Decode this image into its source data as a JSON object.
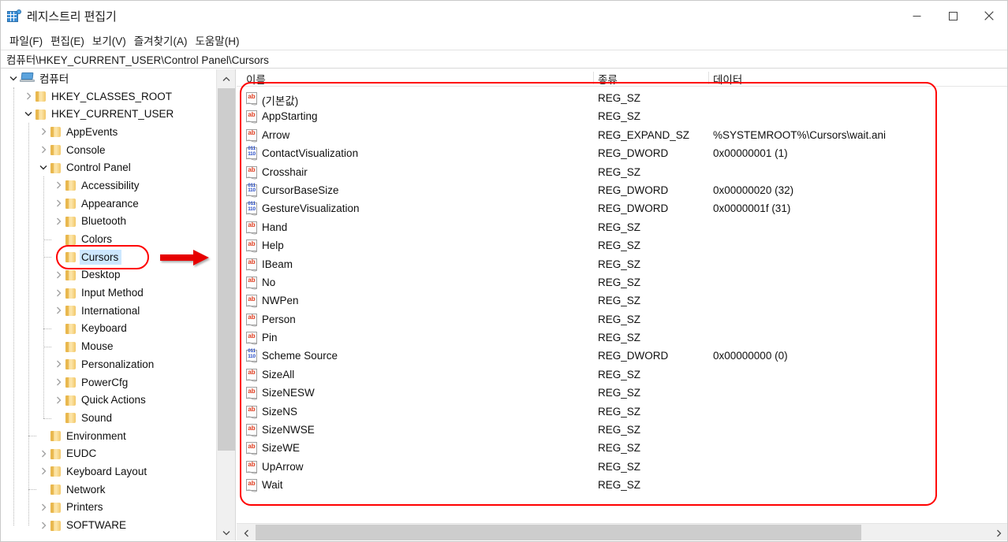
{
  "window": {
    "title": "레지스트리 편집기",
    "icon": "registry-editor-icon",
    "controls": {
      "minimize": "—",
      "maximize": "◻",
      "close": "✕"
    }
  },
  "menubar": {
    "items": [
      {
        "label": "파일(F)",
        "name": "menu-file"
      },
      {
        "label": "편집(E)",
        "name": "menu-edit"
      },
      {
        "label": "보기(V)",
        "name": "menu-view"
      },
      {
        "label": "즐겨찾기(A)",
        "name": "menu-favorites"
      },
      {
        "label": "도움말(H)",
        "name": "menu-help"
      }
    ]
  },
  "addressbar": {
    "path": "컴퓨터\\HKEY_CURRENT_USER\\Control Panel\\Cursors"
  },
  "tree": {
    "nodes": [
      {
        "label": "컴퓨터",
        "depth": 0,
        "expander": "expanded",
        "icon": "computer-icon",
        "selected": false
      },
      {
        "label": "HKEY_CLASSES_ROOT",
        "depth": 1,
        "expander": "collapsed",
        "icon": "folder-icon",
        "selected": false
      },
      {
        "label": "HKEY_CURRENT_USER",
        "depth": 1,
        "expander": "expanded",
        "icon": "folder-icon",
        "selected": false
      },
      {
        "label": "AppEvents",
        "depth": 2,
        "expander": "collapsed",
        "icon": "folder-icon",
        "selected": false
      },
      {
        "label": "Console",
        "depth": 2,
        "expander": "collapsed",
        "icon": "folder-icon",
        "selected": false
      },
      {
        "label": "Control Panel",
        "depth": 2,
        "expander": "expanded",
        "icon": "folder-icon",
        "selected": false
      },
      {
        "label": "Accessibility",
        "depth": 3,
        "expander": "collapsed",
        "icon": "folder-icon",
        "selected": false
      },
      {
        "label": "Appearance",
        "depth": 3,
        "expander": "collapsed",
        "icon": "folder-icon",
        "selected": false
      },
      {
        "label": "Bluetooth",
        "depth": 3,
        "expander": "collapsed",
        "icon": "folder-icon",
        "selected": false
      },
      {
        "label": "Colors",
        "depth": 3,
        "expander": "leaf",
        "icon": "folder-icon",
        "selected": false
      },
      {
        "label": "Cursors",
        "depth": 3,
        "expander": "leaf",
        "icon": "folder-icon",
        "selected": true
      },
      {
        "label": "Desktop",
        "depth": 3,
        "expander": "collapsed",
        "icon": "folder-icon",
        "selected": false
      },
      {
        "label": "Input Method",
        "depth": 3,
        "expander": "collapsed",
        "icon": "folder-icon",
        "selected": false
      },
      {
        "label": "International",
        "depth": 3,
        "expander": "collapsed",
        "icon": "folder-icon",
        "selected": false
      },
      {
        "label": "Keyboard",
        "depth": 3,
        "expander": "leaf",
        "icon": "folder-icon",
        "selected": false
      },
      {
        "label": "Mouse",
        "depth": 3,
        "expander": "leaf",
        "icon": "folder-icon",
        "selected": false
      },
      {
        "label": "Personalization",
        "depth": 3,
        "expander": "collapsed",
        "icon": "folder-icon",
        "selected": false
      },
      {
        "label": "PowerCfg",
        "depth": 3,
        "expander": "collapsed",
        "icon": "folder-icon",
        "selected": false
      },
      {
        "label": "Quick Actions",
        "depth": 3,
        "expander": "collapsed",
        "icon": "folder-icon",
        "selected": false
      },
      {
        "label": "Sound",
        "depth": 3,
        "expander": "leaf",
        "icon": "folder-icon",
        "selected": false
      },
      {
        "label": "Environment",
        "depth": 2,
        "expander": "leaf",
        "icon": "folder-icon",
        "selected": false
      },
      {
        "label": "EUDC",
        "depth": 2,
        "expander": "collapsed",
        "icon": "folder-icon",
        "selected": false
      },
      {
        "label": "Keyboard Layout",
        "depth": 2,
        "expander": "collapsed",
        "icon": "folder-icon",
        "selected": false
      },
      {
        "label": "Network",
        "depth": 2,
        "expander": "leaf",
        "icon": "folder-icon",
        "selected": false
      },
      {
        "label": "Printers",
        "depth": 2,
        "expander": "collapsed",
        "icon": "folder-icon",
        "selected": false
      },
      {
        "label": "SOFTWARE",
        "depth": 2,
        "expander": "collapsed",
        "icon": "folder-icon",
        "selected": false
      }
    ]
  },
  "list": {
    "columns": [
      {
        "label": "이름",
        "name": "column-header-name"
      },
      {
        "label": "종류",
        "name": "column-header-type"
      },
      {
        "label": "데이터",
        "name": "column-header-data"
      }
    ],
    "rows": [
      {
        "name": "(기본값)",
        "type": "REG_SZ",
        "data": "",
        "icon": "string-value-icon"
      },
      {
        "name": "AppStarting",
        "type": "REG_SZ",
        "data": "",
        "icon": "string-value-icon"
      },
      {
        "name": "Arrow",
        "type": "REG_EXPAND_SZ",
        "data": "%SYSTEMROOT%\\Cursors\\wait.ani",
        "icon": "string-value-icon"
      },
      {
        "name": "ContactVisualization",
        "type": "REG_DWORD",
        "data": "0x00000001 (1)",
        "icon": "dword-value-icon"
      },
      {
        "name": "Crosshair",
        "type": "REG_SZ",
        "data": "",
        "icon": "string-value-icon"
      },
      {
        "name": "CursorBaseSize",
        "type": "REG_DWORD",
        "data": "0x00000020 (32)",
        "icon": "dword-value-icon"
      },
      {
        "name": "GestureVisualization",
        "type": "REG_DWORD",
        "data": "0x0000001f (31)",
        "icon": "dword-value-icon"
      },
      {
        "name": "Hand",
        "type": "REG_SZ",
        "data": "",
        "icon": "string-value-icon"
      },
      {
        "name": "Help",
        "type": "REG_SZ",
        "data": "",
        "icon": "string-value-icon"
      },
      {
        "name": "IBeam",
        "type": "REG_SZ",
        "data": "",
        "icon": "string-value-icon"
      },
      {
        "name": "No",
        "type": "REG_SZ",
        "data": "",
        "icon": "string-value-icon"
      },
      {
        "name": "NWPen",
        "type": "REG_SZ",
        "data": "",
        "icon": "string-value-icon"
      },
      {
        "name": "Person",
        "type": "REG_SZ",
        "data": "",
        "icon": "string-value-icon"
      },
      {
        "name": "Pin",
        "type": "REG_SZ",
        "data": "",
        "icon": "string-value-icon"
      },
      {
        "name": "Scheme Source",
        "type": "REG_DWORD",
        "data": "0x00000000 (0)",
        "icon": "dword-value-icon"
      },
      {
        "name": "SizeAll",
        "type": "REG_SZ",
        "data": "",
        "icon": "string-value-icon"
      },
      {
        "name": "SizeNESW",
        "type": "REG_SZ",
        "data": "",
        "icon": "string-value-icon"
      },
      {
        "name": "SizeNS",
        "type": "REG_SZ",
        "data": "",
        "icon": "string-value-icon"
      },
      {
        "name": "SizeNWSE",
        "type": "REG_SZ",
        "data": "",
        "icon": "string-value-icon"
      },
      {
        "name": "SizeWE",
        "type": "REG_SZ",
        "data": "",
        "icon": "string-value-icon"
      },
      {
        "name": "UpArrow",
        "type": "REG_SZ",
        "data": "",
        "icon": "string-value-icon"
      },
      {
        "name": "Wait",
        "type": "REG_SZ",
        "data": "",
        "icon": "string-value-icon"
      }
    ]
  },
  "annotations": {
    "color": "#ff0000",
    "highlight_box_target": "Cursors",
    "value_list_box_target": "value-list",
    "arrow": "right-arrow"
  },
  "colors": {
    "selection": "#cde8ff",
    "annotation": "#ff0000",
    "folder": "#f5cd72",
    "string_icon": "#e03c1e",
    "dword_icon": "#2b50c8"
  }
}
